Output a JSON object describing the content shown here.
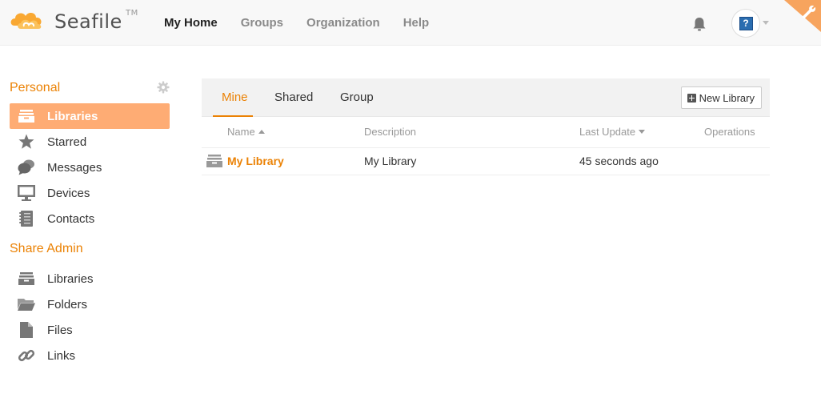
{
  "header": {
    "logo_text": "Seafile",
    "logo_tm": "TM",
    "nav": [
      {
        "label": "My Home",
        "active": true
      },
      {
        "label": "Groups",
        "active": false
      },
      {
        "label": "Organization",
        "active": false
      },
      {
        "label": "Help",
        "active": false
      }
    ],
    "avatar_glyph": "?"
  },
  "sidebar": {
    "personal_heading": "Personal",
    "personal_items": [
      {
        "label": "Libraries",
        "icon": "library-icon",
        "active": true
      },
      {
        "label": "Starred",
        "icon": "star-icon",
        "active": false
      },
      {
        "label": "Messages",
        "icon": "messages-icon",
        "active": false
      },
      {
        "label": "Devices",
        "icon": "monitor-icon",
        "active": false
      },
      {
        "label": "Contacts",
        "icon": "contacts-icon",
        "active": false
      }
    ],
    "share_admin_heading": "Share Admin",
    "share_admin_items": [
      {
        "label": "Libraries",
        "icon": "library-icon"
      },
      {
        "label": "Folders",
        "icon": "folder-icon"
      },
      {
        "label": "Files",
        "icon": "file-icon"
      },
      {
        "label": "Links",
        "icon": "link-icon"
      }
    ]
  },
  "main": {
    "tabs": [
      {
        "label": "Mine",
        "active": true
      },
      {
        "label": "Shared",
        "active": false
      },
      {
        "label": "Group",
        "active": false
      }
    ],
    "new_library_label": "New Library",
    "columns": {
      "name": "Name",
      "description": "Description",
      "last_update": "Last Update",
      "operations": "Operations"
    },
    "rows": [
      {
        "name": "My Library",
        "description": "My Library",
        "last_update": "45 seconds ago"
      }
    ]
  },
  "colors": {
    "accent": "#eb8205",
    "active_bg": "#feac74",
    "icon_gray": "#777777"
  }
}
